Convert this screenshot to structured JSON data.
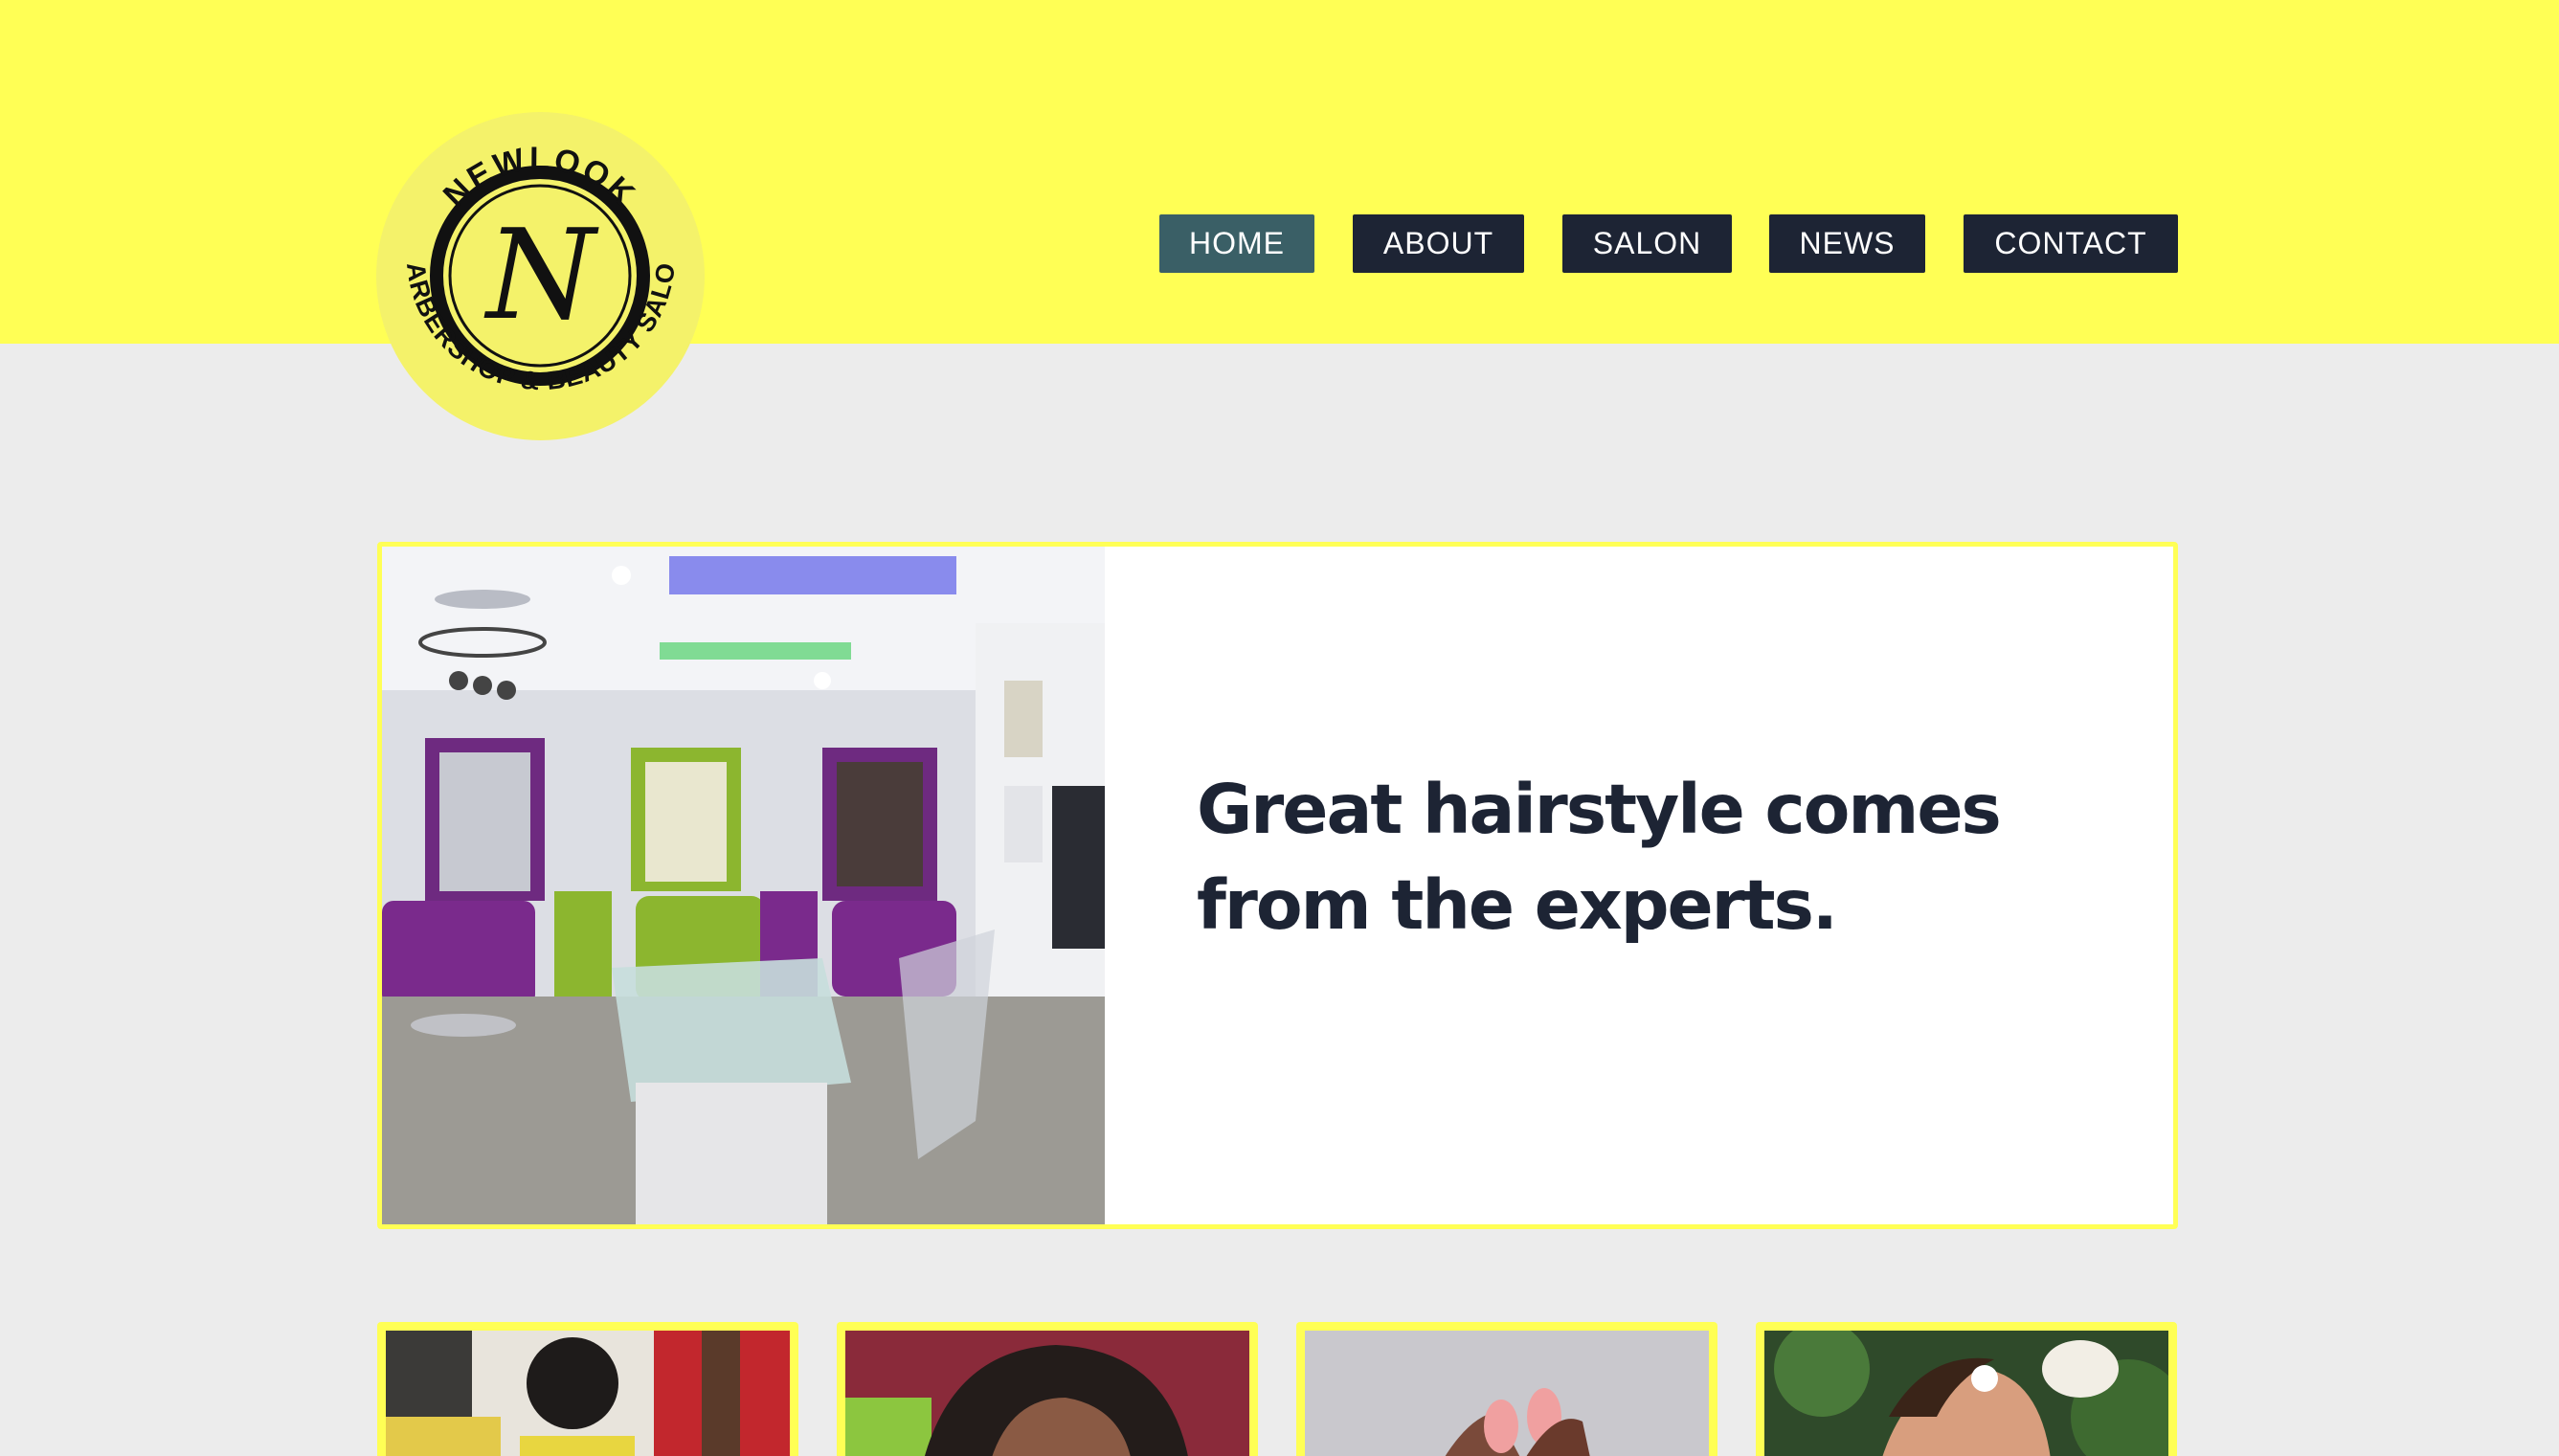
{
  "brand": {
    "logo_top_text": "NEWLOOK",
    "logo_bottom_text": "BARBERSHOP & BEAUTY SALON",
    "logo_monogram": "N"
  },
  "nav": {
    "items": [
      {
        "label": "HOME",
        "active": true
      },
      {
        "label": "ABOUT",
        "active": false
      },
      {
        "label": "SALON",
        "active": false
      },
      {
        "label": "NEWS",
        "active": false
      },
      {
        "label": "CONTACT",
        "active": false
      }
    ]
  },
  "hero": {
    "headline_line1": "Great hairstyle comes",
    "headline_line2": "from the experts.",
    "image_name": "salon-interior-photo"
  },
  "cards": [
    {
      "image_name": "barbershop-haircut-photo"
    },
    {
      "image_name": "hair-styling-photo"
    },
    {
      "image_name": "manicure-nails-photo"
    },
    {
      "image_name": "spa-massage-photo"
    }
  ],
  "colors": {
    "header_bg": "#ffff55",
    "page_bg": "#ececec",
    "nav_bg": "#1d2434",
    "nav_active_bg": "#3a5f66",
    "headline": "#1d2434"
  }
}
